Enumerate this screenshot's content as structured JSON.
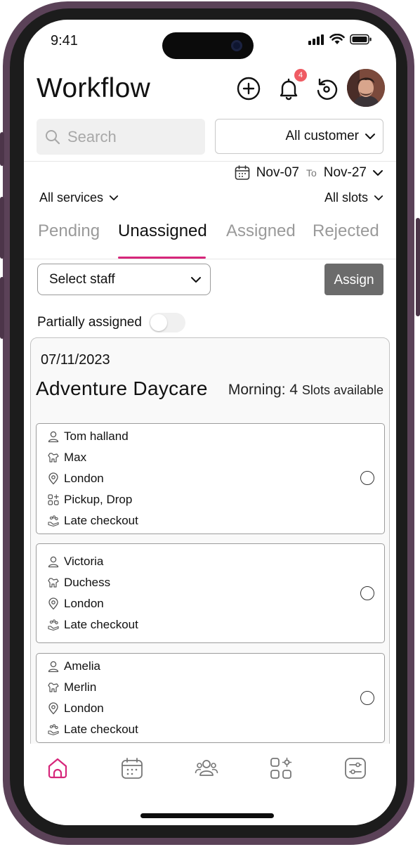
{
  "status_bar": {
    "time": "9:41"
  },
  "header": {
    "title": "Workflow",
    "notification_count": "4"
  },
  "search": {
    "placeholder": "Search"
  },
  "customer_filter": {
    "value": "All customer"
  },
  "date_range": {
    "from": "Nov-07",
    "to_label": "To",
    "to": "Nov-27"
  },
  "filters": {
    "services": "All services",
    "slots": "All slots"
  },
  "tabs": [
    {
      "label": "Pending",
      "active": false
    },
    {
      "label": "Unassigned",
      "active": true
    },
    {
      "label": "Assigned",
      "active": false
    },
    {
      "label": "Rejected",
      "active": false
    }
  ],
  "staff_select": {
    "value": "Select staff"
  },
  "assign_button": {
    "label": "Assign"
  },
  "partial_toggle": {
    "label": "Partially assigned",
    "on": false
  },
  "card": {
    "date": "07/11/2023",
    "name": "Adventure Daycare",
    "slots_prefix": "Morning: 4",
    "slots_suffix": "Slots available",
    "entries": [
      {
        "owner": "Tom halland",
        "pet": "Max",
        "location": "London",
        "services": "Pickup, Drop",
        "extra": "Late checkout"
      },
      {
        "owner": "Victoria",
        "pet": "Duchess",
        "location": "London",
        "extra": "Late checkout"
      },
      {
        "owner": "Amelia",
        "pet": "Merlin",
        "location": "London",
        "extra": "Late checkout"
      }
    ]
  },
  "colors": {
    "accent": "#d6267a",
    "badge": "#ef5b63",
    "assign_button": "#6b6b6b",
    "frame": "#5b4258"
  },
  "nav": {
    "items": [
      "home-icon",
      "calendar-icon",
      "people-icon",
      "apps-icon",
      "settings-icon"
    ],
    "active": "home-icon"
  }
}
